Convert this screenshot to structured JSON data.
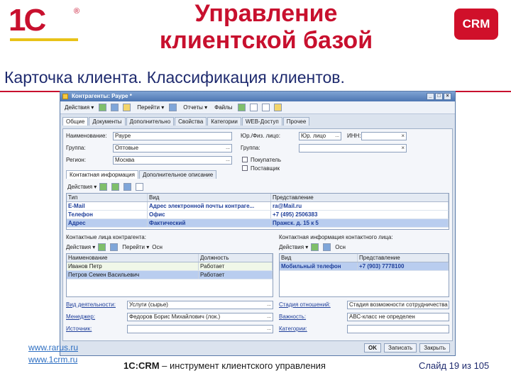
{
  "slide": {
    "title_line1": "Управление",
    "title_line2": "клиентской базой",
    "subtitle": "Карточка клиента. Классификация клиентов.",
    "badge": "CRM",
    "logo_text": "1С",
    "logo_reg": "®"
  },
  "window": {
    "title": "Контрагенты: Рауре *",
    "toolbar": [
      "Действия ▾",
      "Перейти ▾",
      "Отчеты ▾",
      "Файлы"
    ],
    "tabs": [
      "Общие",
      "Документы",
      "Дополнительно",
      "Свойства",
      "Категории",
      "WEB-Доступ",
      "Прочее"
    ],
    "fields": {
      "name_label": "Наименование:",
      "name_value": "Рауре",
      "group_label": "Группа:",
      "group_value": "Оптовые",
      "region_label": "Регион:",
      "region_value": "Москва",
      "legal_label": "Юр./Физ. лицо:",
      "legal_value": "Юр. лицо",
      "inn_label": "ИНН:",
      "subgroup_label": "Группа:",
      "buyer_label": "Покупатель",
      "supplier_label": "Поставщик"
    },
    "contact_tabs": [
      "Контактная информация",
      "Дополнительное описание"
    ],
    "contact_toolbar": "Действия ▾",
    "contact_columns": [
      "Тип",
      "Вид",
      "Представление"
    ],
    "contact_rows": [
      [
        "E-Mail",
        "Адрес электронной почты контраге...",
        "ra@Mail.ru"
      ],
      [
        "Телефон",
        "Офис",
        "+7 (495) 2506383"
      ],
      [
        "Адрес",
        "Фактический",
        "Пражск. д. 15 к 5"
      ]
    ],
    "persons_label": "Контактные лица контрагента:",
    "persons_toolbar": [
      "Действия ▾",
      "Перейти ▾",
      "Осн"
    ],
    "persons_columns": [
      "Наименование",
      "Должность"
    ],
    "persons_rows": [
      [
        "Иванов Петр",
        "Работает"
      ],
      [
        "Петров Семен Васильевич",
        "Работает"
      ]
    ],
    "person_info_label": "Контактная информация контактного лица:",
    "person_info_toolbar": [
      "Действия ▾",
      "Осн"
    ],
    "person_info_columns": [
      "Вид",
      "Представление"
    ],
    "person_info_rows": [
      [
        "Мобильный телефон",
        "+7 (903) 7778100"
      ]
    ],
    "links": {
      "activity_label": "Вид деятельности:",
      "activity_value": "Услуги (сырье)",
      "manager_label": "Менеджер:",
      "manager_value": "Федоров Борис Михайлович (лок.)",
      "source_label": "Источник:",
      "stage_label": "Стадия отношений:",
      "stage_value": "Стадия возможности сотрудничества",
      "importance_label": "Важность:",
      "importance_value": "АВС-класс не определен",
      "category_label": "Категории:"
    },
    "bottom_buttons": [
      "OK",
      "Записать",
      "Закрыть"
    ]
  },
  "footer": {
    "link1": "www.rarus.ru",
    "link2": "www.1crm.ru",
    "center_brand": "1С:CRM",
    "center_text": " – инструмент клиентского управления",
    "slide_no": "Слайд 19 из 105"
  }
}
